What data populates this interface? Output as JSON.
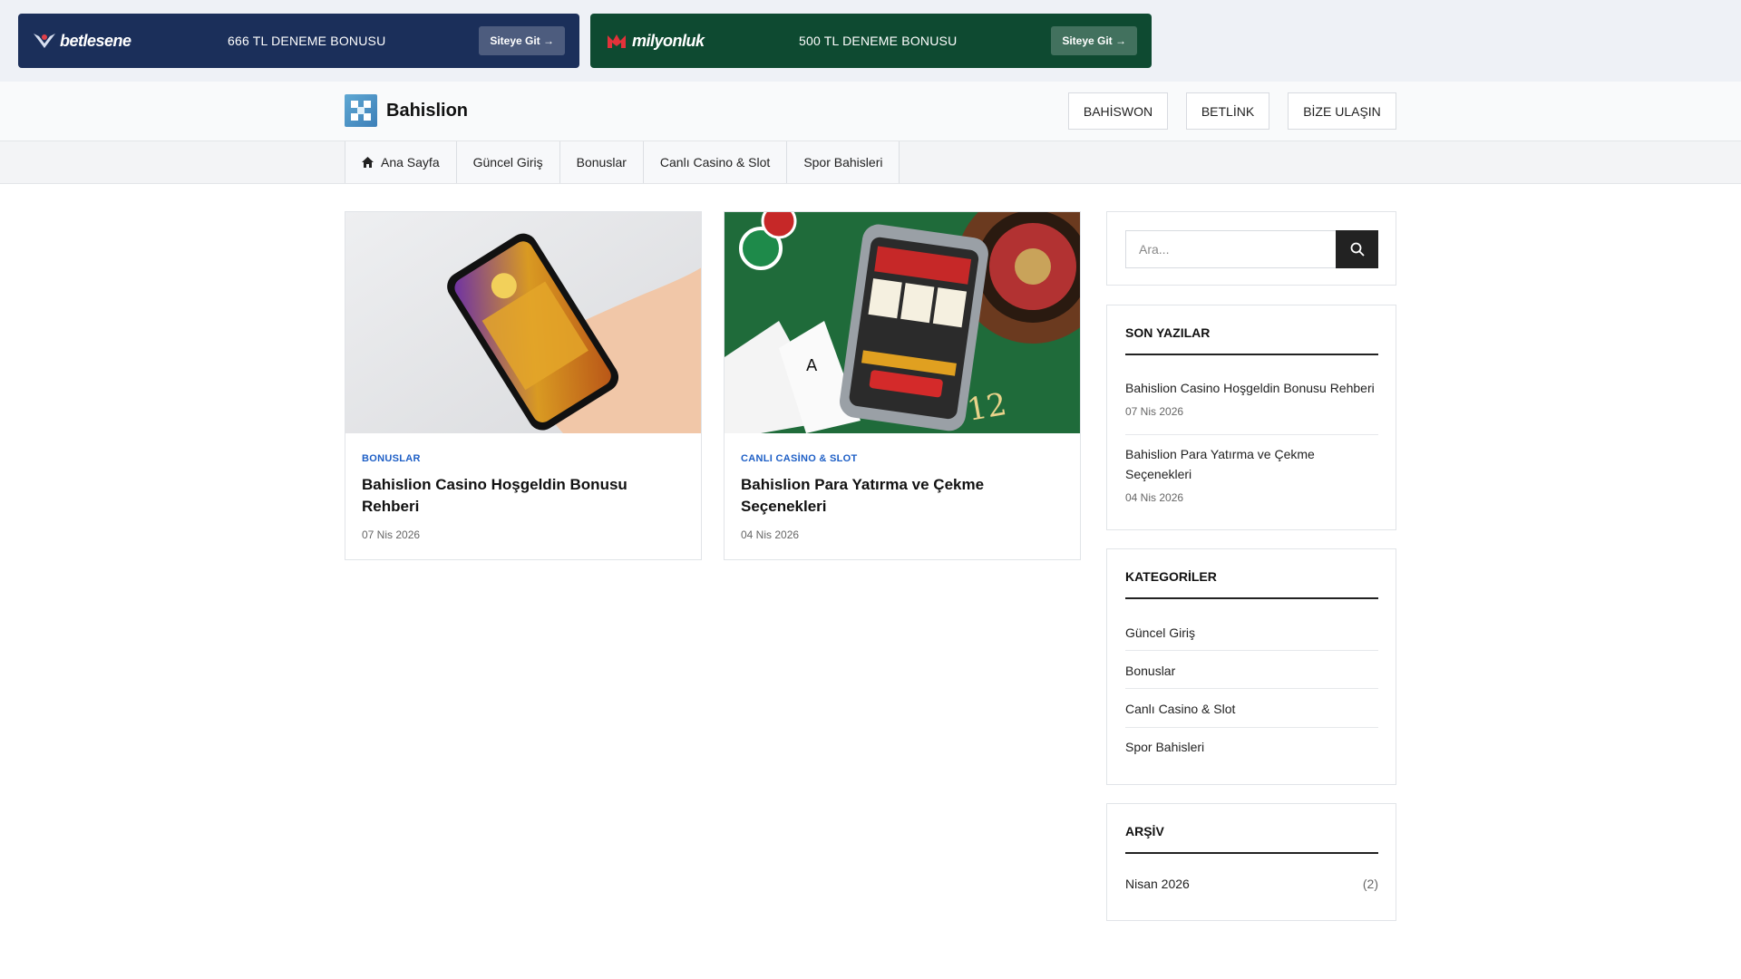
{
  "ads": [
    {
      "brand": "betlesene",
      "bonus": "666 TL DENEME BONUSU",
      "cta": "Siteye Git →",
      "color": "#1b2f5a"
    },
    {
      "brand": "milyonluk",
      "bonus": "500 TL DENEME BONUSU",
      "cta": "Siteye Git →",
      "color": "#0e4a31"
    }
  ],
  "header": {
    "site_name": "Bahislion",
    "buttons": [
      "BAHİSWON",
      "BETLİNK",
      "BİZE ULAŞIN"
    ]
  },
  "nav": {
    "items": [
      "Ana Sayfa",
      "Güncel Giriş",
      "Bonuslar",
      "Canlı Casino & Slot",
      "Spor Bahisleri"
    ]
  },
  "posts": [
    {
      "category": "BONUSLAR",
      "title": "Bahislion Casino Hoşgeldin Bonusu Rehberi",
      "date": "07 Nis 2026"
    },
    {
      "category": "CANLI CASİNO & SLOT",
      "title": "Bahislion Para Yatırma ve Çekme Seçenekleri",
      "date": "04 Nis 2026"
    }
  ],
  "sidebar": {
    "search_placeholder": "Ara...",
    "recent": {
      "heading": "SON YAZILAR",
      "items": [
        {
          "title": "Bahislion Casino Hoşgeldin Bonusu Rehberi",
          "date": "07 Nis 2026"
        },
        {
          "title": "Bahislion Para Yatırma ve Çekme Seçenekleri",
          "date": "04 Nis 2026"
        }
      ]
    },
    "categories": {
      "heading": "KATEGORİLER",
      "items": [
        "Güncel Giriş",
        "Bonuslar",
        "Canlı Casino & Slot",
        "Spor Bahisleri"
      ]
    },
    "archive": {
      "heading": "ARŞİV",
      "items": [
        {
          "label": "Nisan 2026",
          "count": "(2)"
        }
      ]
    }
  }
}
